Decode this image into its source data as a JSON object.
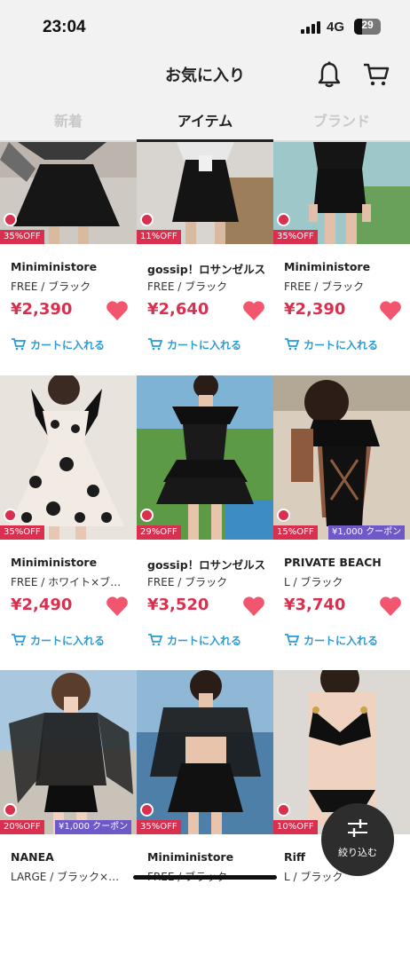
{
  "status_bar": {
    "time": "23:04",
    "network": "4G",
    "battery": "29"
  },
  "header": {
    "title": "お気に入り"
  },
  "tabs": [
    {
      "label": "新着"
    },
    {
      "label": "アイテム"
    },
    {
      "label": "ブランド"
    }
  ],
  "products": [
    {
      "brand": "Miniministore",
      "variant": "FREE / ブラック",
      "price": "¥2,390",
      "discount": "35%OFF",
      "coupon": "",
      "add_to_cart": "カートに入れる"
    },
    {
      "brand": "gossip！ロサンゼルス",
      "variant": "FREE / ブラック",
      "price": "¥2,640",
      "discount": "11%OFF",
      "coupon": "",
      "add_to_cart": "カートに入れる"
    },
    {
      "brand": "Miniministore",
      "variant": "FREE / ブラック",
      "price": "¥2,390",
      "discount": "35%OFF",
      "coupon": "",
      "add_to_cart": "カートに入れる"
    },
    {
      "brand": "Miniministore",
      "variant": "FREE / ホワイト×ブ…",
      "price": "¥2,490",
      "discount": "35%OFF",
      "coupon": "",
      "add_to_cart": "カートに入れる"
    },
    {
      "brand": "gossip！ロサンゼルス",
      "variant": "FREE / ブラック",
      "price": "¥3,520",
      "discount": "29%OFF",
      "coupon": "",
      "add_to_cart": "カートに入れる"
    },
    {
      "brand": "PRIVATE  BEACH",
      "variant": "L / ブラック",
      "price": "¥3,740",
      "discount": "15%OFF",
      "coupon": "¥1,000 クーポン",
      "add_to_cart": "カートに入れる"
    },
    {
      "brand": "NANEA",
      "variant": "LARGE / ブラック×…",
      "price": "",
      "discount": "20%OFF",
      "coupon": "¥1,000 クーポン",
      "add_to_cart": ""
    },
    {
      "brand": "Miniministore",
      "variant": "FREE / ブラック",
      "price": "",
      "discount": "35%OFF",
      "coupon": "",
      "add_to_cart": ""
    },
    {
      "brand": "Riff",
      "variant": "L / ブラック",
      "price": "",
      "discount": "10%OFF",
      "coupon": "",
      "add_to_cart": ""
    }
  ],
  "filter_button": {
    "label": "絞り込む"
  },
  "colors": {
    "accent_red": "#d9304f",
    "heart_pink": "#f2566f",
    "link_blue": "#2a9bd6",
    "coupon_purple": "#6f59c8"
  },
  "icons": [
    "bell-icon",
    "cart-icon",
    "heart-icon",
    "timer-icon",
    "filter-icon"
  ]
}
